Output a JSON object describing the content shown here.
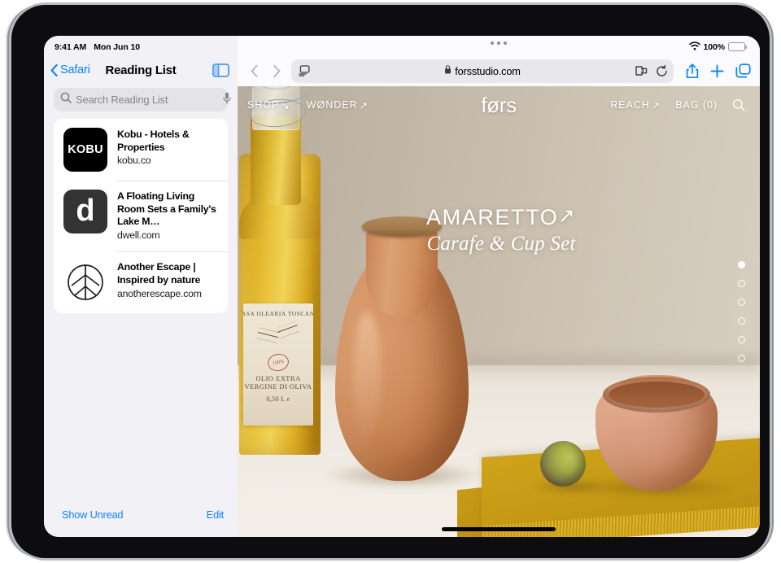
{
  "status_bar": {
    "time": "9:41 AM",
    "date": "Mon Jun 10",
    "battery_percent": "100%",
    "wifi_icon": "wifi-icon",
    "battery_icon": "battery-icon"
  },
  "sidebar": {
    "back_label": "Safari",
    "title": "Reading List",
    "toggle_icon": "sidebar-toggle-icon",
    "search": {
      "placeholder": "Search Reading List",
      "value": "",
      "search_icon": "search-icon",
      "mic_icon": "microphone-icon"
    },
    "items": [
      {
        "title": "Kobu - Hotels & Properties",
        "url": "kobu.co",
        "icon_type": "kobu-wordmark",
        "icon_text": "KOBU"
      },
      {
        "title": "A Floating Living Room Sets a Family's Lake M…",
        "url": "dwell.com",
        "icon_type": "dwell-letter",
        "icon_text": "d"
      },
      {
        "title": "Another Escape | Inspired by nature",
        "url": "anotherescape.com",
        "icon_type": "leaf-circle",
        "icon_text": ""
      }
    ],
    "footer": {
      "show_unread": "Show Unread",
      "edit": "Edit"
    }
  },
  "browser": {
    "multitask_icon": "multitask-handle-icon",
    "back_icon": "chevron-left-icon",
    "forward_icon": "chevron-right-icon",
    "address_bar": {
      "url": "forsstudio.com",
      "lock_icon": "lock-icon",
      "reader_icon": "page-settings-icon",
      "extensions_icon": "extensions-puzzle-icon",
      "reload_icon": "reload-icon"
    },
    "share_icon": "share-icon",
    "new_tab_icon": "plus-icon",
    "tabs_icon": "tab-overview-icon"
  },
  "webpage": {
    "nav_left": [
      {
        "label": "SHOP",
        "arrow": "↘"
      },
      {
        "label": "WØNDER",
        "arrow": "↗"
      }
    ],
    "logo": "førs",
    "nav_right": [
      {
        "label": "REACH",
        "arrow": "↗"
      },
      {
        "label": "BAG (0)",
        "arrow": ""
      }
    ],
    "search_icon": "search-icon",
    "hero": {
      "title": "AMARETTO",
      "title_arrow": "↗",
      "subtitle": "Carafe & Cup Set"
    },
    "carousel": {
      "total": 6,
      "active_index": 0
    },
    "product_photo": {
      "bottle_label_brand": "CASA OLEARIA TOSCANA",
      "bottle_label_seal": "100%",
      "bottle_label_lines": "OLIO EXTRA VERGINE DI OLIVA",
      "bottle_label_volume": "0,50 L e"
    }
  },
  "home_indicator": "home-indicator",
  "colors": {
    "accent_blue": "#0a84ff",
    "sidebar_bg": "#f2f2f6",
    "card_bg": "#ffffff",
    "hero_wall": "#c5b9a9",
    "carafe": "#cf8d5d",
    "cup": "#d79b7d",
    "cloth": "#c79b16"
  }
}
